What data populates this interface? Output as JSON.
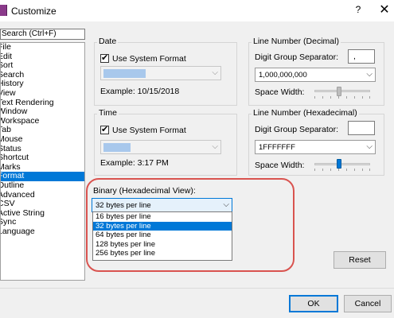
{
  "window": {
    "title": "Customize",
    "help": "?",
    "close": "✕"
  },
  "search": {
    "placeholder": "Search (Ctrl+F)"
  },
  "nav": {
    "items": [
      "File",
      "Edit",
      "Sort",
      "Search",
      "History",
      "View",
      "Text Rendering",
      "Window",
      "Workspace",
      "Tab",
      "Mouse",
      "Status",
      "Shortcut",
      "Marks",
      "Format",
      "Outline",
      "Advanced",
      "CSV",
      "Active String",
      "Sync",
      "Language"
    ],
    "selected": "Format"
  },
  "date": {
    "group_label": "Date",
    "use_system_label": "Use System Format",
    "checked": true,
    "example": "Example: 10/15/2018"
  },
  "time": {
    "group_label": "Time",
    "use_system_label": "Use System Format",
    "checked": true,
    "example": "Example: 3:17 PM"
  },
  "line_decimal": {
    "group_label": "Line Number (Decimal)",
    "separator_label": "Digit Group Separator:",
    "separator_value": ",",
    "format_value": "1,000,000,000",
    "space_width_label": "Space Width:",
    "space_width_level": 0.4
  },
  "line_hex": {
    "group_label": "Line Number (Hexadecimal)",
    "separator_label": "Digit Group Separator:",
    "separator_value": "",
    "format_value": "1FFFFFFF",
    "space_width_label": "Space Width:",
    "space_width_level": 0.4
  },
  "binary": {
    "label": "Binary (Hexadecimal View):",
    "selected": "32 bytes per line",
    "options": [
      "16 bytes per line",
      "32 bytes per line",
      "64 bytes per line",
      "128 bytes per line",
      "256 bytes per line"
    ]
  },
  "buttons": {
    "reset": "Reset",
    "ok": "OK",
    "cancel": "Cancel"
  },
  "colors": {
    "accent": "#0078d7",
    "highlight_oval": "#d9534f"
  }
}
